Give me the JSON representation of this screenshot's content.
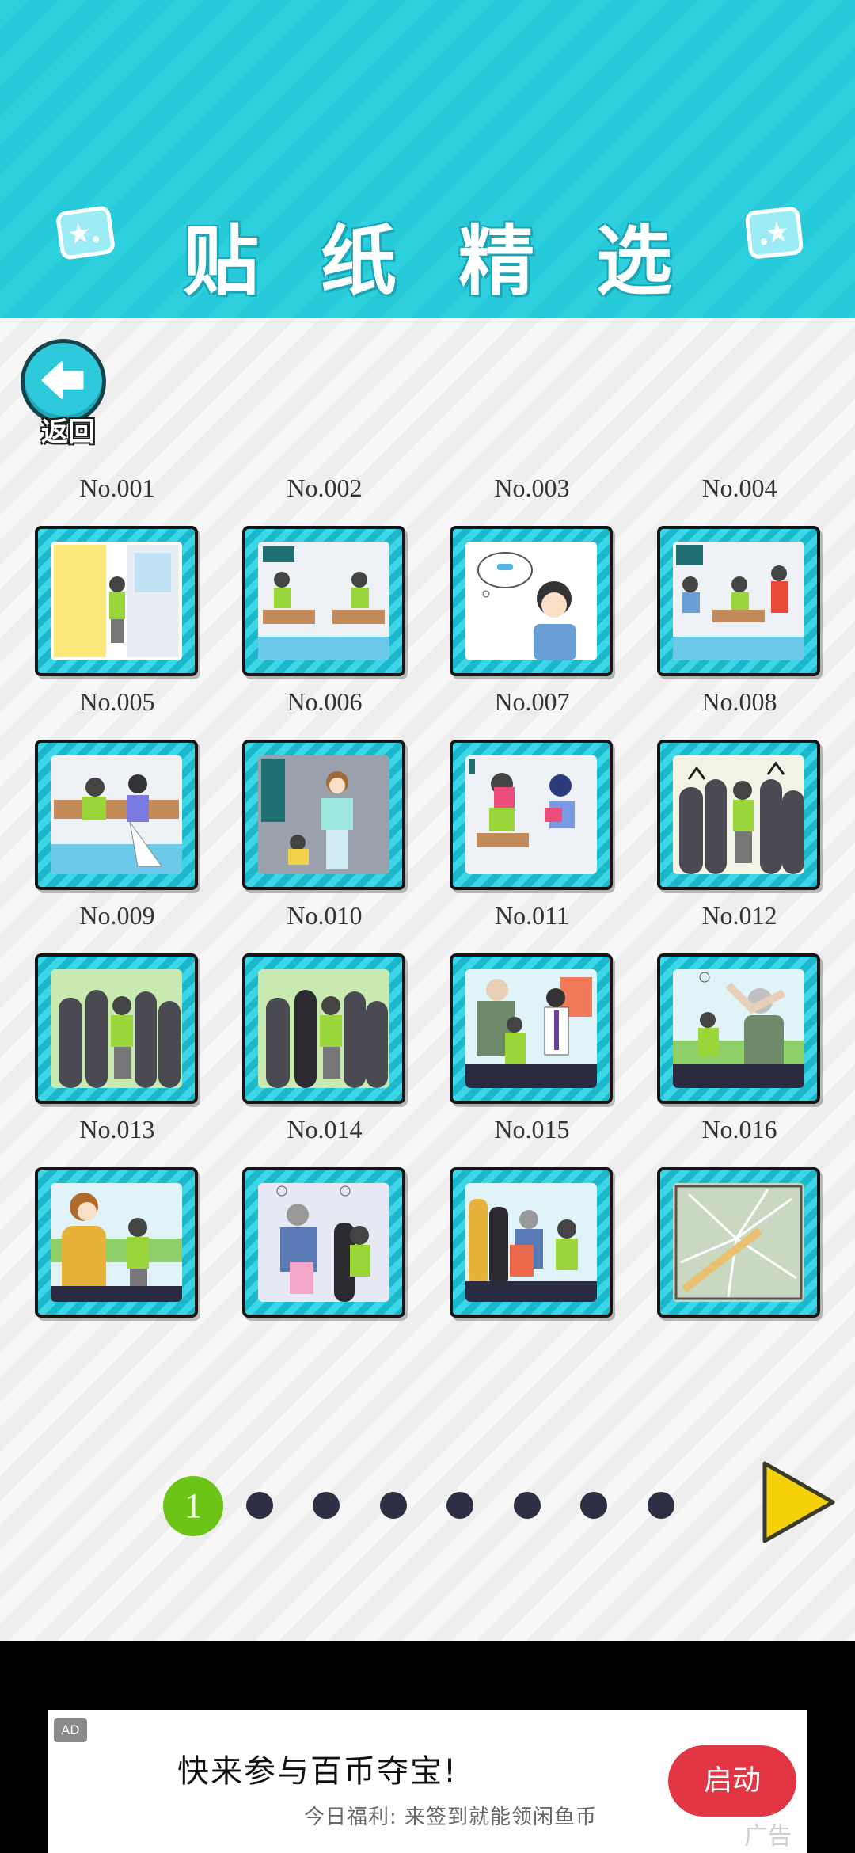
{
  "header": {
    "title": "贴纸精选"
  },
  "back_button": {
    "label": "返回"
  },
  "stickers": [
    {
      "label": "No.001"
    },
    {
      "label": "No.002"
    },
    {
      "label": "No.003"
    },
    {
      "label": "No.004"
    },
    {
      "label": "No.005"
    },
    {
      "label": "No.006"
    },
    {
      "label": "No.007"
    },
    {
      "label": "No.008"
    },
    {
      "label": "No.009"
    },
    {
      "label": "No.010"
    },
    {
      "label": "No.011"
    },
    {
      "label": "No.012"
    },
    {
      "label": "No.013"
    },
    {
      "label": "No.014"
    },
    {
      "label": "No.015"
    },
    {
      "label": "No.016"
    }
  ],
  "pagination": {
    "current_page": "1",
    "total_pages": 8
  },
  "ad": {
    "badge": "AD",
    "title": "快来参与百币夺宝!",
    "subtitle": "今日福利: 来签到就能领闲鱼币",
    "cta": "启动",
    "mark": "广告"
  },
  "colors": {
    "header": "#2ed0de",
    "frame": "#1bb8cc",
    "current_page": "#6cc417",
    "page_dot": "#2e2e44",
    "next_arrow": "#f5d10a",
    "ad_cta": "#e23645"
  },
  "icons": {
    "deco": "star-card-icon",
    "back": "back-arrow-icon",
    "next": "play-arrow-icon"
  }
}
